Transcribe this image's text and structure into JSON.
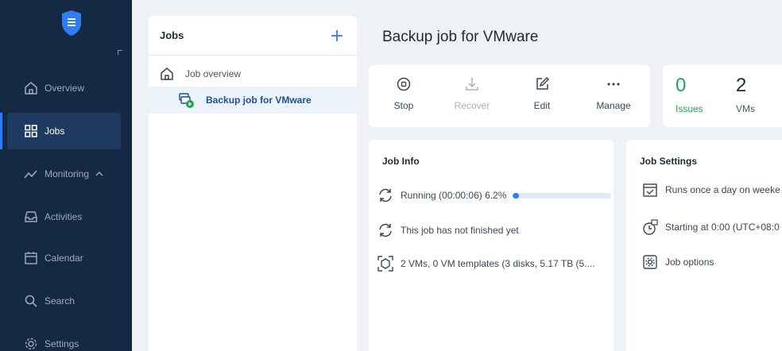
{
  "sidebar": {
    "items": [
      {
        "label": "Overview",
        "icon": "home-icon"
      },
      {
        "label": "Jobs",
        "icon": "grid-icon",
        "active": true
      },
      {
        "label": "Monitoring",
        "icon": "trend-icon",
        "expanded": true
      },
      {
        "label": "Activities",
        "icon": "inbox-icon"
      },
      {
        "label": "Calendar",
        "icon": "calendar-icon"
      },
      {
        "label": "Search",
        "icon": "search-icon"
      },
      {
        "label": "Settings",
        "icon": "gear-icon"
      }
    ]
  },
  "jobs_panel": {
    "title": "Jobs",
    "overview_label": "Job overview",
    "selected_job": "Backup job for VMware"
  },
  "main": {
    "title": "Backup job for VMware",
    "toolbar": {
      "stop": "Stop",
      "recover": "Recover",
      "edit": "Edit",
      "manage": "Manage"
    },
    "stats": {
      "issues_value": "0",
      "issues_label": "Issues",
      "vms_value": "2",
      "vms_label": "VMs"
    },
    "job_info": {
      "title": "Job Info",
      "running": "Running (00:00:06)  6.2%",
      "progress_percent": 6.2,
      "not_finished": "This job has not finished yet",
      "summary": "2 VMs, 0 VM templates (3 disks, 5.17 TB (5...."
    },
    "job_settings": {
      "title": "Job Settings",
      "schedule": "Runs once a day on weeke",
      "start_time": "Starting at 0:00 (UTC+08:0",
      "options": "Job options"
    }
  },
  "colors": {
    "sidebar_bg": "#152844",
    "accent": "#2e7cf6",
    "success": "#22a555"
  }
}
